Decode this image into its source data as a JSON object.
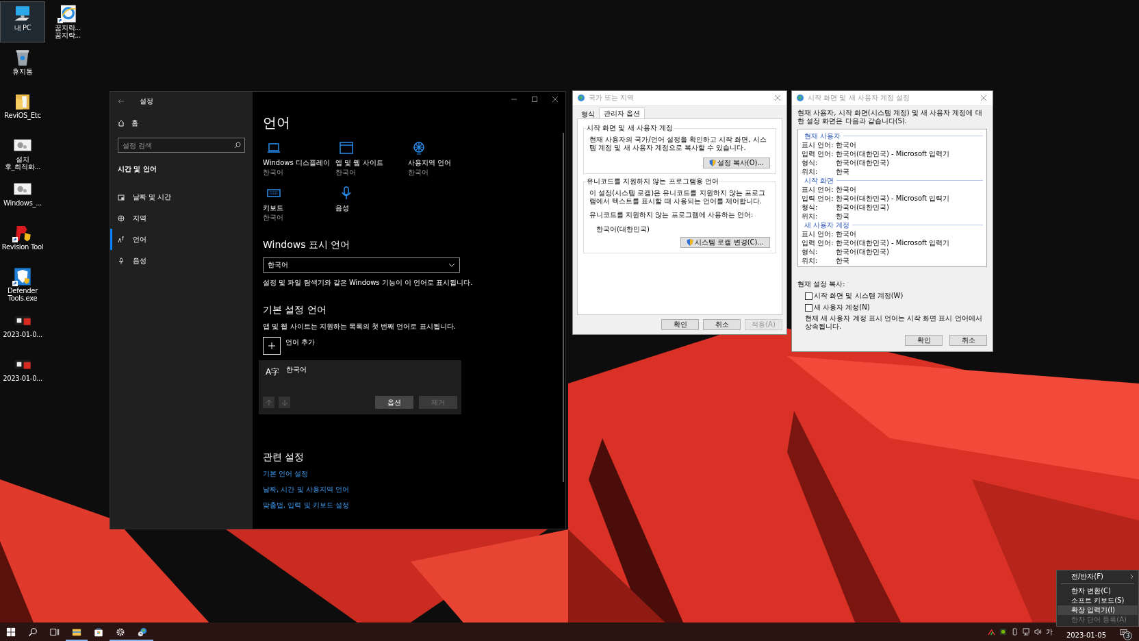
{
  "desktop": {
    "icons": [
      {
        "kind": "pc",
        "lines": [
          "내 PC"
        ],
        "selected": true,
        "shortcut": false
      },
      {
        "kind": "recycle",
        "lines": [
          "휴지통"
        ],
        "selected": false,
        "shortcut": false
      },
      {
        "kind": "folder",
        "lines": [
          "ReviOS_Etc"
        ],
        "selected": false,
        "shortcut": false
      },
      {
        "kind": "setup",
        "lines": [
          "설치",
          "후_최적화..."
        ],
        "selected": false,
        "shortcut": false
      },
      {
        "kind": "setup",
        "lines": [
          "Windows_..."
        ],
        "selected": false,
        "shortcut": false
      },
      {
        "kind": "revision",
        "lines": [
          "Revision Tool"
        ],
        "selected": false,
        "shortcut": true
      },
      {
        "kind": "defender",
        "lines": [
          "Defender",
          "Tools.exe"
        ],
        "selected": false,
        "shortcut": true
      },
      {
        "kind": "screenshot",
        "lines": [
          "2023-01-0..."
        ],
        "selected": false,
        "shortcut": false
      },
      {
        "kind": "screenshot",
        "lines": [
          "2023-01-0..."
        ],
        "selected": false,
        "shortcut": false
      },
      {
        "kind": "ie",
        "lines": [
          "꿈지락...",
          "꿈지락..."
        ],
        "selected": false,
        "shortcut": true
      }
    ]
  },
  "settings_window": {
    "title": "설정",
    "home": "홈",
    "search": {
      "placeholder": "설정 검색"
    },
    "section": "시간 및 언어",
    "nav": [
      {
        "kind": "calendar",
        "label": "날짜 및 시간",
        "selected": false
      },
      {
        "kind": "globe",
        "label": "지역",
        "selected": false
      },
      {
        "kind": "language",
        "label": "언어",
        "selected": true
      },
      {
        "kind": "mic",
        "label": "음성",
        "selected": false
      }
    ],
    "page_title": "언어",
    "tiles": [
      {
        "kind": "laptop",
        "title": "Windows 디스플레이",
        "subtitle": "한국어"
      },
      {
        "kind": "window",
        "title": "앱 및 웹 사이트",
        "subtitle": "한국어"
      },
      {
        "kind": "globe",
        "title": "사용지역 언어",
        "subtitle": "한국어"
      },
      {
        "kind": "keyboard",
        "title": "키보드",
        "subtitle": "한국어"
      },
      {
        "kind": "mic",
        "title": "음성"
      }
    ],
    "display_language": {
      "heading": "Windows 표시 언어",
      "value": "한국어",
      "description": "설정 및 파일 탐색기와 같은 Windows 기능이 이 언어로 표시됩니다."
    },
    "preferred": {
      "heading": "기본 설정 언어",
      "description": "앱 및 웹 사이트는 지원하는 목록의 첫 번째 언어로 표시됩니다.",
      "add_label": "언어 추가",
      "languages": [
        {
          "glyph": "A字",
          "name": "한국어",
          "selected": true,
          "arrows": [
            {
              "kind": "up",
              "disabled": true
            },
            {
              "kind": "down",
              "disabled": true
            }
          ],
          "buttons": [
            {
              "label": "옵션",
              "disabled": false
            },
            {
              "label": "제거",
              "disabled": true
            }
          ]
        }
      ]
    },
    "related": {
      "heading": "관련 설정",
      "links": [
        "기본 언어 설정",
        "날짜, 시간 및 사용지역 언어",
        "맞춤법, 입력 및 키보드 설정"
      ]
    }
  },
  "region_dialog": {
    "title": "국가 또는 지역",
    "tabs": [
      {
        "label": "형식",
        "selected": false
      },
      {
        "label": "관리자 옵션",
        "selected": true
      }
    ],
    "groups": [
      {
        "legend": "시작 화면 및 새 사용자 계정",
        "paragraphs": [
          "현재 사용자의 국가/언어 설정을 확인하고 시작 화면, 시스템 계정 및 새 사용자 계정으로 복사할 수 있습니다."
        ],
        "button": "설정 복사(O)..."
      },
      {
        "legend": "유니코드를 지원하지 않는 프로그램용 언어",
        "paragraphs": [
          "이 설정(시스템 로캘)은 유니코드를 지원하지 않는 프로그램에서 텍스트를 표시할 때 사용되는 언어를 제어합니다.",
          "유니코드를 지원하지 않는 프로그램에 사용하는 언어:"
        ],
        "value": "한국어(대한민국)",
        "button": "시스템 로캘 변경(C)..."
      }
    ],
    "buttons": [
      {
        "label": "확인",
        "disabled": false
      },
      {
        "label": "취소",
        "disabled": false
      },
      {
        "label": "적용(A)",
        "disabled": true
      }
    ]
  },
  "copy_dialog": {
    "title": "시작 화면 및 새 사용자 계정 설정",
    "intro": "현재 사용자, 시작 화면(시스템 계정) 및 새 사용자 계정에 대한 설정 화면은 다음과 같습니다(S).",
    "sections": [
      {
        "heading": "현재 사용자",
        "rows": [
          {
            "label": "표시 언어:",
            "value": "한국어"
          },
          {
            "label": "입력 언어:",
            "value": "한국어(대한민국) - Microsoft 입력기"
          },
          {
            "label": "형식:",
            "value": "한국어(대한민국)"
          },
          {
            "label": "위치:",
            "value": "한국"
          }
        ]
      },
      {
        "heading": "시작 화면",
        "rows": [
          {
            "label": "표시 언어:",
            "value": "한국어"
          },
          {
            "label": "입력 언어:",
            "value": "한국어(대한민국) - Microsoft 입력기"
          },
          {
            "label": "형식:",
            "value": "한국어(대한민국)"
          },
          {
            "label": "위치:",
            "value": "한국"
          }
        ]
      },
      {
        "heading": "새 사용자 계정",
        "rows": [
          {
            "label": "표시 언어:",
            "value": "한국어"
          },
          {
            "label": "입력 언어:",
            "value": "한국어(대한민국) - Microsoft 입력기"
          },
          {
            "label": "형식:",
            "value": "한국어(대한민국)"
          },
          {
            "label": "위치:",
            "value": "한국"
          }
        ]
      }
    ],
    "copy_label": "현재 설정 복사:",
    "checkboxes": [
      {
        "label": "시작 화면 및 시스템 계정(W)",
        "checked": false
      },
      {
        "label": "새 사용자 계정(N)",
        "checked": false
      }
    ],
    "note": "현재 새 사용자 계정 표시 언어는 시작 화면 표시 언어에서 상속됩니다.",
    "buttons": [
      "확인",
      "취소"
    ]
  },
  "context_menu": {
    "sections": [
      [
        {
          "label": "전/반자(F)",
          "submenu": true,
          "selected": false,
          "disabled": false
        }
      ],
      [
        {
          "label": "한자 변환(C)",
          "submenu": false,
          "selected": false,
          "disabled": false
        },
        {
          "label": "소프트 키보드(S)",
          "submenu": false,
          "selected": false,
          "disabled": false
        },
        {
          "label": "확장 입력기(I)",
          "submenu": false,
          "selected": true,
          "disabled": false
        },
        {
          "label": "한자 단어 등록(A)",
          "submenu": false,
          "selected": false,
          "disabled": true
        }
      ]
    ]
  },
  "taskbar": {
    "apps": [
      {
        "kind": "start",
        "open": false
      },
      {
        "kind": "search",
        "open": false
      },
      {
        "kind": "taskview",
        "open": false
      },
      {
        "kind": "explorer",
        "open": true
      },
      {
        "kind": "store",
        "open": false
      },
      {
        "kind": "settings",
        "open": true
      },
      {
        "kind": "region",
        "open": true
      }
    ],
    "tray": {
      "ime": "가",
      "date": "2023-01-05",
      "notifications": "3"
    }
  }
}
